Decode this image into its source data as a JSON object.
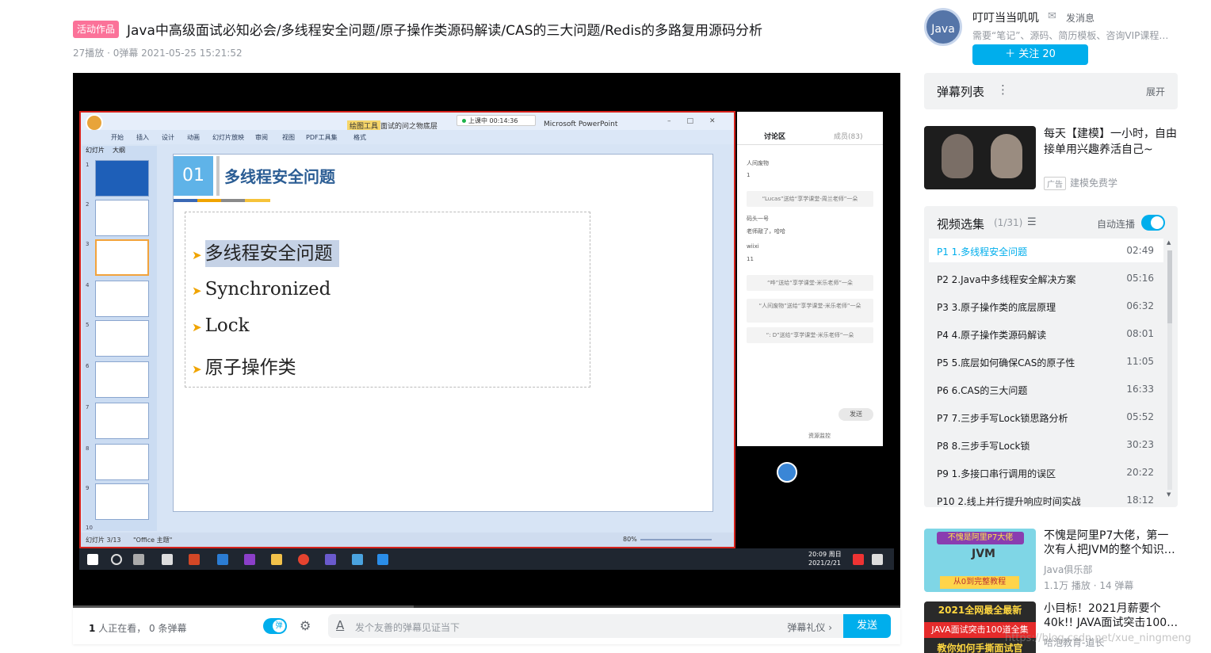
{
  "video": {
    "badge": "活动作品",
    "title": "Java中高级面试必知必会/多线程安全问题/原子操作类源码解读/CAS的三大问题/Redis的多路复用源码分析",
    "meta": "27播放 · 0弹幕    2021-05-25 15:21:52"
  },
  "player_screen": {
    "ppt_title": "Microsoft PowerPoint",
    "ppt_tools_label": "绘图工具",
    "ppt_file": "面试的问之物底层",
    "live_status": "上课中 00:14:36",
    "ribbon_tabs": [
      "开始",
      "插入",
      "设计",
      "动画",
      "幻灯片放映",
      "审阅",
      "视图",
      "PDF工具集",
      "格式"
    ],
    "panel_tabs": [
      "幻灯片",
      "大纲"
    ],
    "thumb_numbers": [
      "1",
      "2",
      "3",
      "4",
      "5",
      "6",
      "7",
      "8",
      "9",
      "10"
    ],
    "slide": {
      "num": "01",
      "heading": "多线程安全问题",
      "bullets": [
        "多线程安全问题",
        "Synchronized",
        "Lock",
        "原子操作类"
      ]
    },
    "status_left": "幻灯片 3/13",
    "status_theme": "\"Office 主题\"",
    "zoom": "80%",
    "chat": {
      "tab_discuss": "讨论区",
      "tab_members": "成员(83)",
      "messages": [
        "人间废物",
        "1",
        "“Lucas”送给“享学课堂-周兰老师”一朵",
        "码头一号",
        "老师敲了，哈哈",
        "wiixi",
        "11",
        "“哗”送给“享学课堂-米乐老师”一朵",
        "“人间废物”送给“享学课堂-米乐老师”一朵",
        "“: D”送给“享学课堂-米乐老师”一朵"
      ],
      "send": "发送",
      "resource": "资源监控"
    },
    "clock_time": "20:09 周日",
    "clock_date": "2021/2/21"
  },
  "danmaku_bar": {
    "viewers_count": "1",
    "viewers_text": "人正在看，",
    "danmaku_count": "0 条弹幕",
    "toggle_label": "弹",
    "placeholder": "发个友善的弹幕见证当下",
    "etiquette": "弹幕礼仪 ›",
    "send": "发送"
  },
  "uploader": {
    "avatar_text": "Java",
    "name": "叮叮当当叽叽",
    "message_label": "发消息",
    "description": "需要“笔记”、源码、简历模板、咨询VIP课程，...",
    "follow": "＋  关注 20"
  },
  "danmaku_list": {
    "title": "弹幕列表",
    "expand": "展开"
  },
  "ad": {
    "title": "每天【建模】一小时，自由接单用兴趣养活自己~",
    "tag": "广告",
    "source": "建模免费学"
  },
  "episodes": {
    "title": "视频选集",
    "count": "(1/31)",
    "autoplay": "自动连播",
    "items": [
      {
        "p": "P1   1.多线程安全问题",
        "dur": "02:49"
      },
      {
        "p": "P2   2.Java中多线程安全解决方案",
        "dur": "05:16"
      },
      {
        "p": "P3   3.原子操作类的底层原理",
        "dur": "06:32"
      },
      {
        "p": "P4   4.原子操作类源码解读",
        "dur": "08:01"
      },
      {
        "p": "P5   5.底层如何确保CAS的原子性",
        "dur": "11:05"
      },
      {
        "p": "P6   6.CAS的三大问题",
        "dur": "16:33"
      },
      {
        "p": "P7   7.三步手写Lock锁思路分析",
        "dur": "05:52"
      },
      {
        "p": "P8   8.三步手写Lock锁",
        "dur": "30:23"
      },
      {
        "p": "P9   1.多接口串行调用的误区",
        "dur": "20:22"
      },
      {
        "p": "P10   2.线上并行提升响应时间实战",
        "dur": "18:12"
      }
    ]
  },
  "recommend": [
    {
      "title": "不愧是阿里P7大佬，第一次有人把JVM的整个知识…",
      "up": "Java俱乐部",
      "stat": "1.1万 播放 · 14 弹幕",
      "cover_top": "不愧是阿里P7大佬",
      "cover_mid": "JVM",
      "cover_bot": "从0到完整教程"
    },
    {
      "title": "小目标！2021月薪要个40k!! JAVA面试突击100…",
      "up": "哈泡教育-道长",
      "cover_l1": "2021全网最全最新",
      "cover_l2": "JAVA面试突击100道全集",
      "cover_l3": "教你如何手撕面试官"
    }
  ],
  "watermark": "https://blog.csdn.net/xue_ningmeng",
  "colors": {
    "accent": "#00aeec",
    "badge": "#fb7299"
  }
}
